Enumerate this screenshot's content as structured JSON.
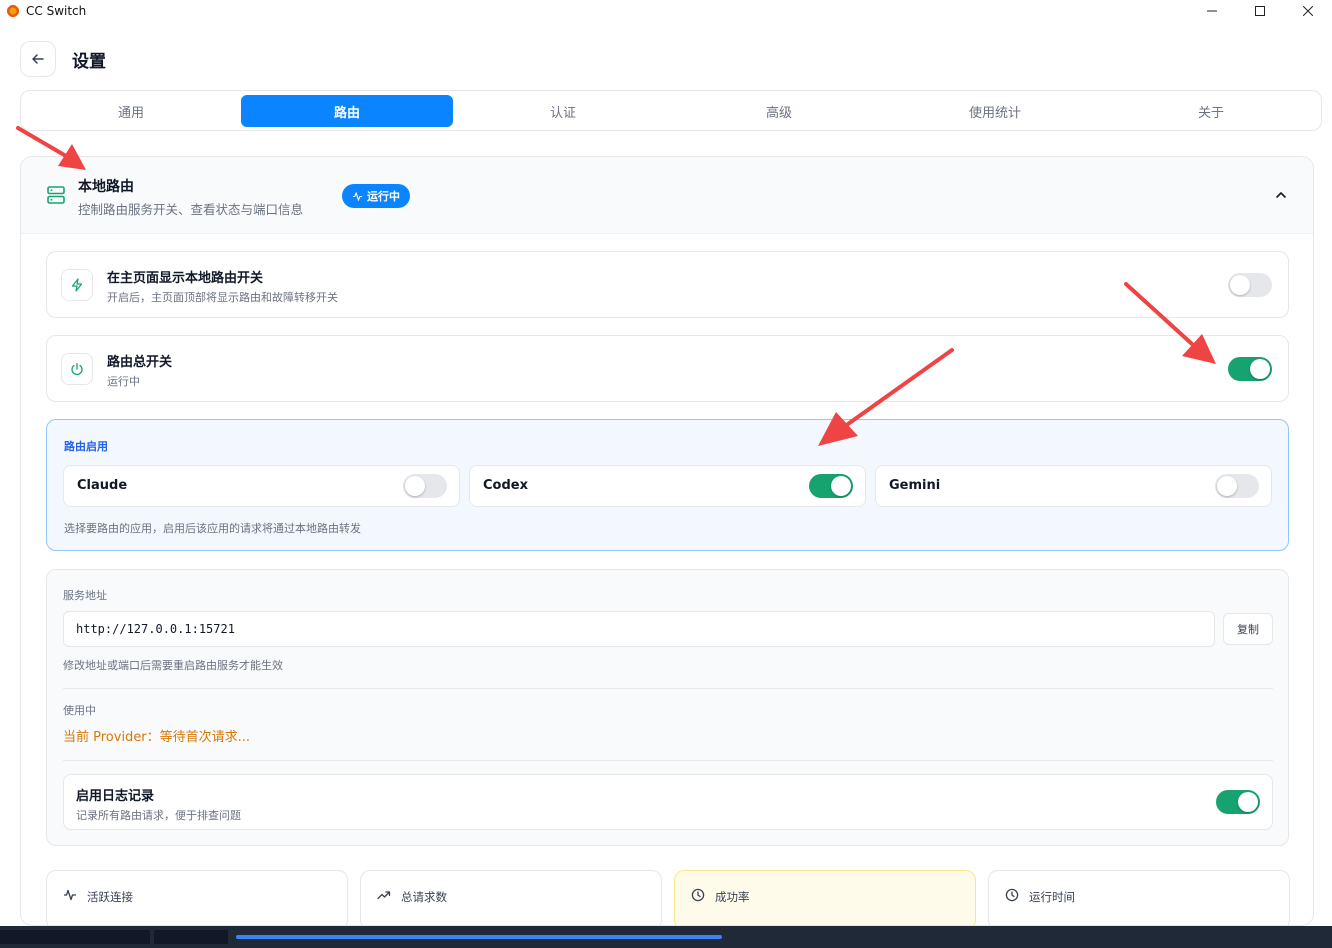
{
  "window": {
    "title": "CC Switch"
  },
  "header": {
    "title": "设置"
  },
  "tabs": [
    {
      "label": "通用"
    },
    {
      "label": "路由"
    },
    {
      "label": "认证"
    },
    {
      "label": "高级"
    },
    {
      "label": "使用统计"
    },
    {
      "label": "关于"
    }
  ],
  "active_tab": "路由",
  "panel": {
    "title": "本地路由",
    "subtitle": "控制路由服务开关、查看状态与端口信息",
    "badge": "运行中"
  },
  "show_toggle_card": {
    "title": "在主页面显示本地路由开关",
    "subtitle": "开启后，主页面顶部将显示路由和故障转移开关",
    "enabled": false
  },
  "master_card": {
    "title": "路由总开关",
    "subtitle": "运行中",
    "enabled": true
  },
  "routing": {
    "label": "路由启用",
    "apps": [
      {
        "name": "Claude",
        "enabled": false
      },
      {
        "name": "Codex",
        "enabled": true
      },
      {
        "name": "Gemini",
        "enabled": false
      }
    ],
    "hint": "选择要路由的应用，启用后该应用的请求将通过本地路由转发"
  },
  "server": {
    "address_label": "服务地址",
    "address_value": "http://127.0.0.1:15721",
    "copy_label": "复制",
    "restart_hint": "修改地址或端口后需要重启路由服务才能生效",
    "in_use_label": "使用中",
    "provider_text": "当前 Provider：等待首次请求..."
  },
  "logging": {
    "title": "启用日志记录",
    "subtitle": "记录所有路由请求，便于排查问题",
    "enabled": true
  },
  "stats": [
    {
      "label": "活跃连接",
      "icon": "activity-icon"
    },
    {
      "label": "总请求数",
      "icon": "trending-up-icon"
    },
    {
      "label": "成功率",
      "icon": "clock-icon"
    },
    {
      "label": "运行时间",
      "icon": "clock-icon"
    }
  ],
  "colors": {
    "accent": "#0a84ff",
    "toggle_on": "#16a36f",
    "provider_warning": "#d97706",
    "annotation_arrow": "#ef4444"
  }
}
